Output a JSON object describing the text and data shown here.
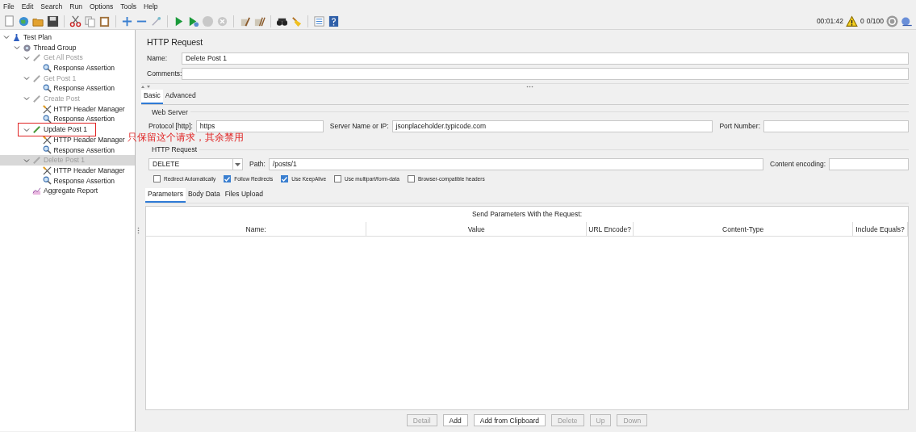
{
  "menu": [
    {
      "label": "File"
    },
    {
      "label": "Edit"
    },
    {
      "label": "Search"
    },
    {
      "label": "Run"
    },
    {
      "label": "Options"
    },
    {
      "label": "Tools"
    },
    {
      "label": "Help"
    }
  ],
  "status": {
    "elapsed": "00:01:42",
    "warnings": "0",
    "threads": "0/100"
  },
  "tree": [
    {
      "label": "Test Plan",
      "kind": "plan",
      "disabled": false,
      "selected": false,
      "expanded": true,
      "children": [
        {
          "label": "Thread Group",
          "kind": "threads",
          "disabled": false,
          "selected": false,
          "expanded": true,
          "children": [
            {
              "label": "Get All Posts",
              "kind": "sampler",
              "disabled": true,
              "selected": false,
              "expanded": true,
              "children": [
                {
                  "label": "Response Assertion",
                  "kind": "assertion",
                  "disabled": false,
                  "selected": false
                }
              ]
            },
            {
              "label": "Get Post 1",
              "kind": "sampler",
              "disabled": true,
              "selected": false,
              "expanded": true,
              "children": [
                {
                  "label": "Response Assertion",
                  "kind": "assertion",
                  "disabled": false,
                  "selected": false
                }
              ]
            },
            {
              "label": "Create Post",
              "kind": "sampler",
              "disabled": true,
              "selected": false,
              "expanded": true,
              "children": [
                {
                  "label": "HTTP Header Manager",
                  "kind": "headers",
                  "disabled": false,
                  "selected": false
                },
                {
                  "label": "Response Assertion",
                  "kind": "assertion",
                  "disabled": false,
                  "selected": false
                }
              ]
            },
            {
              "label": "Update Post 1",
              "kind": "sampler",
              "disabled": false,
              "selected": false,
              "expanded": true,
              "children": [
                {
                  "label": "HTTP Header Manager",
                  "kind": "headers",
                  "disabled": false,
                  "selected": false
                },
                {
                  "label": "Response Assertion",
                  "kind": "assertion",
                  "disabled": false,
                  "selected": false
                }
              ]
            },
            {
              "label": "Delete Post 1",
              "kind": "sampler",
              "disabled": true,
              "selected": true,
              "expanded": true,
              "children": [
                {
                  "label": "HTTP Header Manager",
                  "kind": "headers",
                  "disabled": false,
                  "selected": false
                },
                {
                  "label": "Response Assertion",
                  "kind": "assertion",
                  "disabled": false,
                  "selected": false
                }
              ]
            },
            {
              "label": "Aggregate Report",
              "kind": "report",
              "disabled": false,
              "selected": false
            }
          ]
        }
      ]
    }
  ],
  "annotation": {
    "text": "只保留这个请求，其余禁用"
  },
  "editor": {
    "title": "HTTP Request",
    "name_label": "Name:",
    "name": "Delete Post 1",
    "comments_label": "Comments:",
    "tabs": [
      {
        "label": "Basic",
        "selected": true
      },
      {
        "label": "Advanced",
        "selected": false
      }
    ],
    "web_server": {
      "legend": "Web Server",
      "protocol_label": "Protocol [http]:",
      "protocol": "https",
      "server_label": "Server Name or IP:",
      "server": "jsonplaceholder.typicode.com",
      "port_label": "Port Number:"
    },
    "http_request": {
      "legend": "HTTP Request",
      "method": "DELETE",
      "path_label": "Path:",
      "path": "/posts/1",
      "encoding_label": "Content encoding:",
      "options": [
        {
          "label": "Redirect Automatically",
          "checked": false
        },
        {
          "label": "Follow Redirects",
          "checked": true
        },
        {
          "label": "Use KeepAlive",
          "checked": true
        },
        {
          "label": "Use multipart/form-data",
          "checked": false
        },
        {
          "label": "Browser-compatible headers",
          "checked": false
        }
      ]
    },
    "param_tabs": [
      {
        "label": "Parameters",
        "selected": true
      },
      {
        "label": "Body Data",
        "selected": false
      },
      {
        "label": "Files Upload",
        "selected": false
      }
    ],
    "table": {
      "caption": "Send Parameters With the Request:",
      "columns": [
        "Name:",
        "Value",
        "URL Encode?",
        "Content-Type",
        "Include Equals?"
      ]
    },
    "buttons": [
      {
        "label": "Detail",
        "disabled": true
      },
      {
        "label": "Add",
        "disabled": false
      },
      {
        "label": "Add from Clipboard",
        "disabled": false
      },
      {
        "label": "Delete",
        "disabled": true
      },
      {
        "label": "Up",
        "disabled": true
      },
      {
        "label": "Down",
        "disabled": true
      }
    ]
  }
}
